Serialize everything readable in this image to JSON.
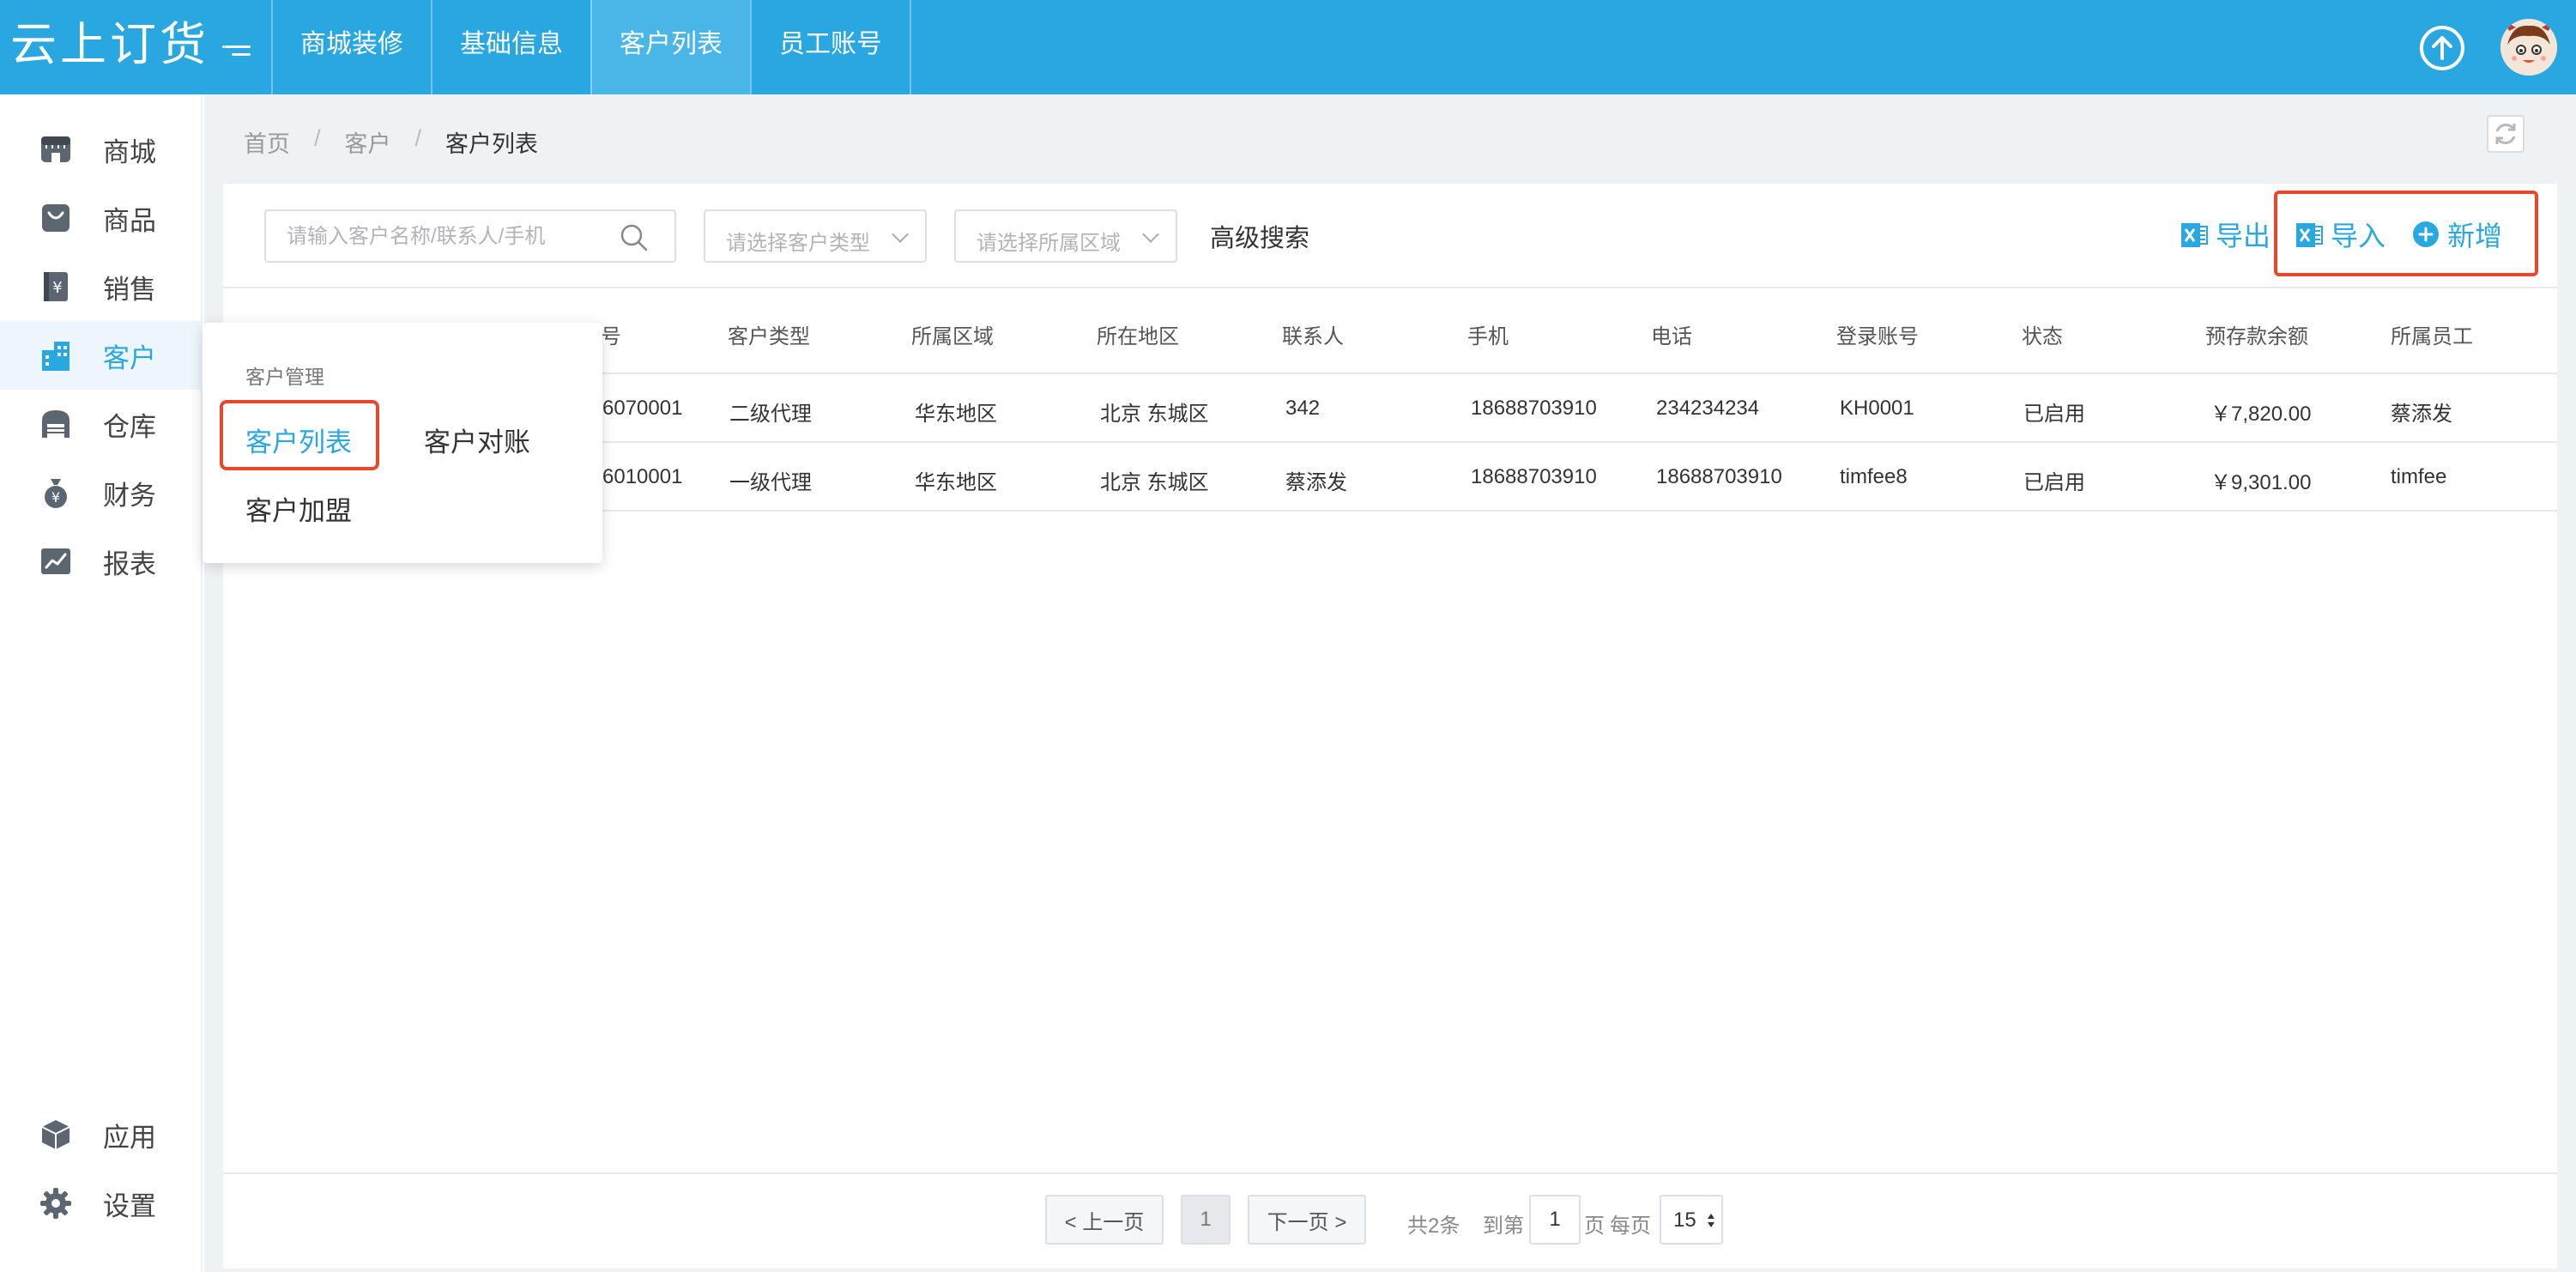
{
  "app": {
    "logo": "云上订货"
  },
  "topnav": {
    "tabs": [
      "商城装修",
      "基础信息",
      "客户列表",
      "员工账号"
    ],
    "active": 2
  },
  "sidebar": {
    "items": [
      {
        "label": "商城",
        "icon": "store-icon"
      },
      {
        "label": "商品",
        "icon": "bag-icon"
      },
      {
        "label": "销售",
        "icon": "yen-book-icon"
      },
      {
        "label": "客户",
        "icon": "building-icon"
      },
      {
        "label": "仓库",
        "icon": "warehouse-icon"
      },
      {
        "label": "财务",
        "icon": "money-bag-icon"
      },
      {
        "label": "报表",
        "icon": "chart-icon"
      }
    ],
    "bottom_items": [
      {
        "label": "应用",
        "icon": "cube-icon"
      },
      {
        "label": "设置",
        "icon": "gear-icon"
      }
    ],
    "active": "客户"
  },
  "breadcrumb": {
    "home": "首页",
    "level1": "客户",
    "current": "客户列表",
    "separator": "/"
  },
  "filters": {
    "search_placeholder": "请输入客户名称/联系人/手机",
    "type_placeholder": "请选择客户类型",
    "region_placeholder": "请选择所属区域",
    "advanced_search": "高级搜索"
  },
  "actions": {
    "export": "导出",
    "import": "导入",
    "add": "新增"
  },
  "table": {
    "columns": [
      "号",
      "客户类型",
      "所属区域",
      "所在地区",
      "联系人",
      "手机",
      "电话",
      "登录账号",
      "状态",
      "预存款余额",
      "所属员工"
    ],
    "rows": [
      [
        "6070001",
        "二级代理",
        "华东地区",
        "北京 东城区",
        "342",
        "18688703910",
        "234234234",
        "KH0001",
        "已启用",
        "￥7,820.00",
        "蔡添发"
      ],
      [
        "6010001",
        "一级代理",
        "华东地区",
        "北京 东城区",
        "蔡添发",
        "18688703910",
        "18688703910",
        "timfee8",
        "已启用",
        "￥9,301.00",
        "timfee"
      ]
    ]
  },
  "popover": {
    "group_title": "客户管理",
    "items": [
      "客户列表",
      "客户对账",
      "客户加盟"
    ]
  },
  "pagination": {
    "prev": "< 上一页",
    "page": "1",
    "next": "下一页 >",
    "total": "共2条",
    "goto_label": "到第",
    "goto_value": "1",
    "page_unit": "页",
    "per_page_label": "每页",
    "per_page": "15"
  },
  "colors": {
    "primary": "#29a7e1",
    "highlight": "#e8472c",
    "background": "#eff2f5"
  }
}
